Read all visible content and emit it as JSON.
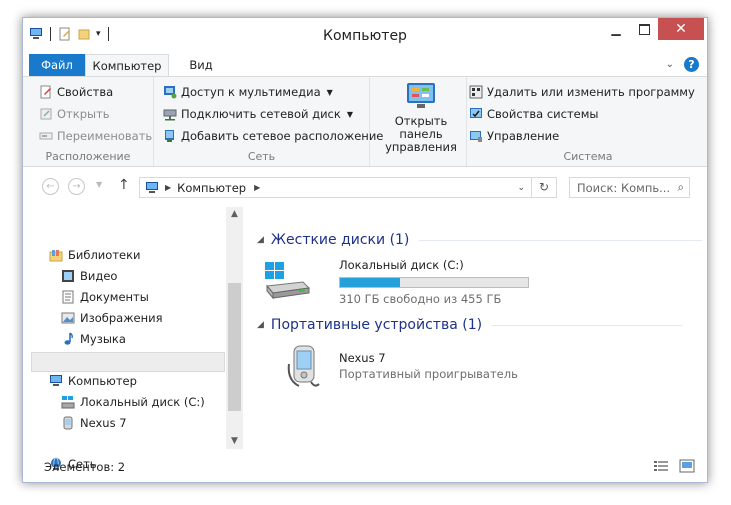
{
  "window": {
    "title": "Компьютер"
  },
  "ribbon_tabs": {
    "file": "Файл",
    "computer": "Компьютер",
    "view": "Вид"
  },
  "ribbon": {
    "location": {
      "label": "Расположение",
      "properties": "Свойства",
      "open": "Открыть",
      "rename": "Переименовать"
    },
    "network": {
      "label": "Сеть",
      "media_access": "Доступ к мультимедиа",
      "map_drive": "Подключить сетевой диск",
      "add_location": "Добавить сетевое расположение"
    },
    "control_panel": {
      "label_line1": "Открыть панель",
      "label_line2": "управления"
    },
    "system": {
      "label": "Система",
      "uninstall": "Удалить или изменить программу",
      "system_properties": "Свойства системы",
      "manage": "Управление"
    }
  },
  "address_bar": {
    "path": "Компьютер",
    "search_placeholder": "Поиск: Компь..."
  },
  "nav_pane": {
    "libraries": "Библиотеки",
    "video": "Видео",
    "documents": "Документы",
    "images": "Изображения",
    "music": "Музыка",
    "computer": "Компьютер",
    "local_disk": "Локальный диск (C:)",
    "nexus": "Nexus 7",
    "network": "Сеть"
  },
  "content": {
    "hard_disks_header": "Жесткие диски (1)",
    "disk_name": "Локальный диск (C:)",
    "disk_free": "310 ГБ свободно из 455 ГБ",
    "disk_used_fraction": 0.32,
    "portable_header": "Портативные устройства (1)",
    "device_name": "Nexus 7",
    "device_type": "Портативный проигрыватель"
  },
  "status": {
    "items": "Элементов: 2"
  },
  "colors": {
    "accent": "#1979ca",
    "progress": "#26a0da",
    "group_header": "#1e3287",
    "close": "#c75050"
  }
}
